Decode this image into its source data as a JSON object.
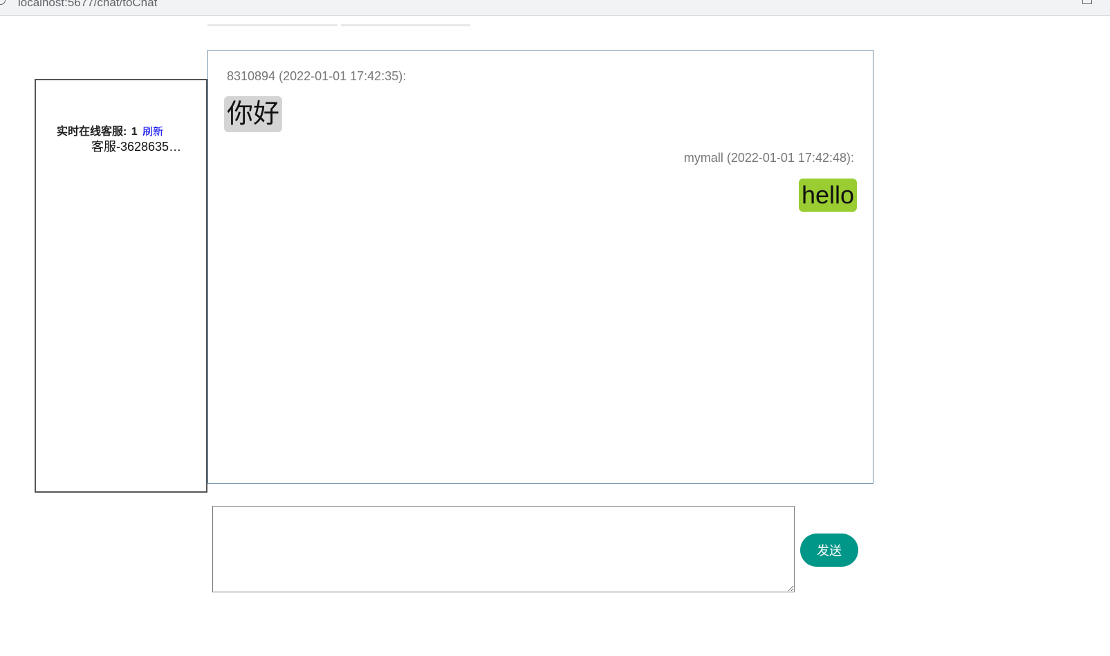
{
  "browser": {
    "url": "localhost:5677/chat/toChat",
    "info_icon": "info-icon",
    "share_icon": "share-icon"
  },
  "sidebar": {
    "online_label": "实时在线客服:",
    "online_count": "1",
    "refresh_label": "刷新",
    "agents": [
      {
        "name": "客服-3628635…"
      }
    ]
  },
  "chat": {
    "messages": [
      {
        "sender": "8310894",
        "time": "2022-01-01 17:42:35",
        "header": "8310894 (2022-01-01 17:42:35):",
        "text": "你好",
        "side": "left",
        "bubble_color": "#d4d4d4"
      },
      {
        "sender": "mymall",
        "time": "2022-01-01 17:42:48",
        "header": "mymall (2022-01-01 17:42:48):",
        "text": "hello",
        "side": "right",
        "bubble_color": "#9acd32"
      }
    ]
  },
  "composer": {
    "value": "",
    "send_label": "发送",
    "send_color": "#009688"
  },
  "colors": {
    "link": "#0000ee",
    "chat_border": "#6e8ea8",
    "sidebar_border": "#555555"
  }
}
